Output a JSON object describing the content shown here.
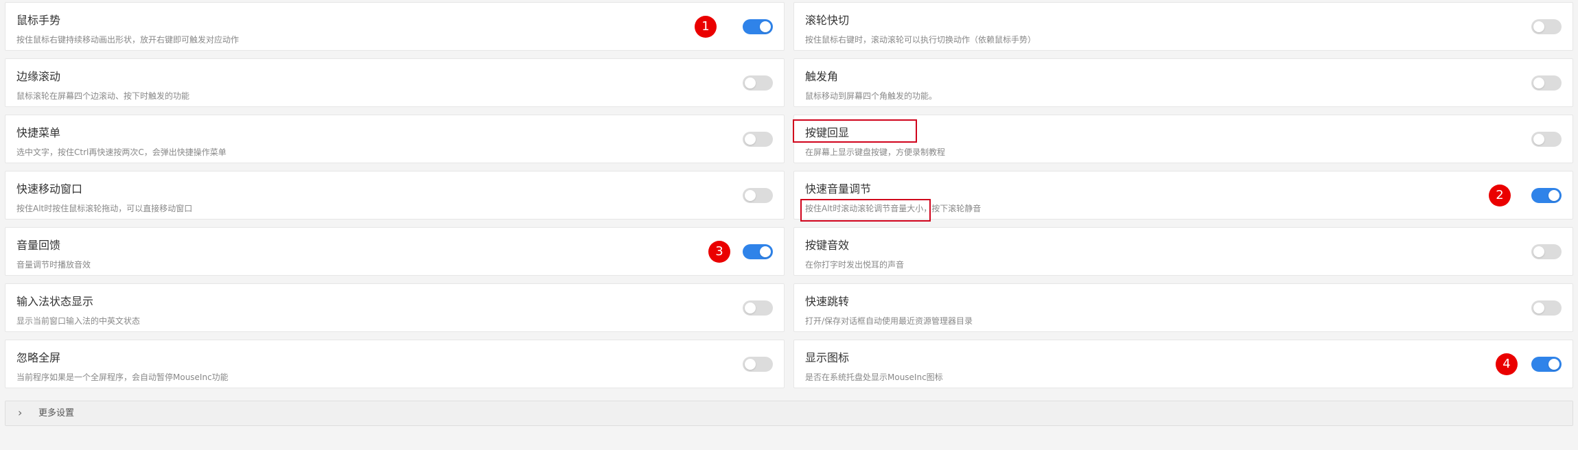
{
  "settings": {
    "left": [
      {
        "title": "鼠标手势",
        "desc": "按住鼠标右键持续移动画出形状，放开右键即可触发对应动作",
        "on": true,
        "marker": "1"
      },
      {
        "title": "边缘滚动",
        "desc": "鼠标滚轮在屏幕四个边滚动、按下时触发的功能",
        "on": false
      },
      {
        "title": "快捷菜单",
        "desc": "选中文字，按住Ctrl再快速按两次C，会弹出快捷操作菜单",
        "on": false
      },
      {
        "title": "快速移动窗口",
        "desc": "按住Alt时按住鼠标滚轮拖动，可以直接移动窗口",
        "on": false
      },
      {
        "title": "音量回馈",
        "desc": "音量调节时播放音效",
        "on": true,
        "marker": "3"
      },
      {
        "title": "输入法状态显示",
        "desc": "显示当前窗口输入法的中英文状态",
        "on": false
      },
      {
        "title": "忽略全屏",
        "desc": "当前程序如果是一个全屏程序，会自动暂停MouseInc功能",
        "on": false
      }
    ],
    "right": [
      {
        "title": "滚轮快切",
        "desc": "按住鼠标右键时，滚动滚轮可以执行切换动作（依赖鼠标手势）",
        "on": false
      },
      {
        "title": "触发角",
        "desc": "鼠标移动到屏幕四个角触发的功能。",
        "on": false
      },
      {
        "title": "按键回显",
        "desc": "在屏幕上显示键盘按键，方便录制教程",
        "on": false
      },
      {
        "title": "快速音量调节",
        "desc": "按住Alt时滚动滚轮调节音量大小，按下滚轮静音",
        "on": true,
        "marker": "2"
      },
      {
        "title": "按键音效",
        "desc": "在你打字时发出悦耳的声音",
        "on": false
      },
      {
        "title": "快速跳转",
        "desc": "打开/保存对话框自动使用最近资源管理器目录",
        "on": false
      },
      {
        "title": "显示图标",
        "desc": "是否在系统托盘处显示MouseInc图标",
        "on": true,
        "marker": "4"
      }
    ]
  },
  "more_settings": {
    "icon": "chevron-right-icon",
    "chevron": "›",
    "label": "更多设置"
  },
  "colors": {
    "toggle_on": "#2f83e9",
    "toggle_off": "#dcdcdc",
    "marker": "#ea0000",
    "highlight_box": "#d0021b"
  }
}
